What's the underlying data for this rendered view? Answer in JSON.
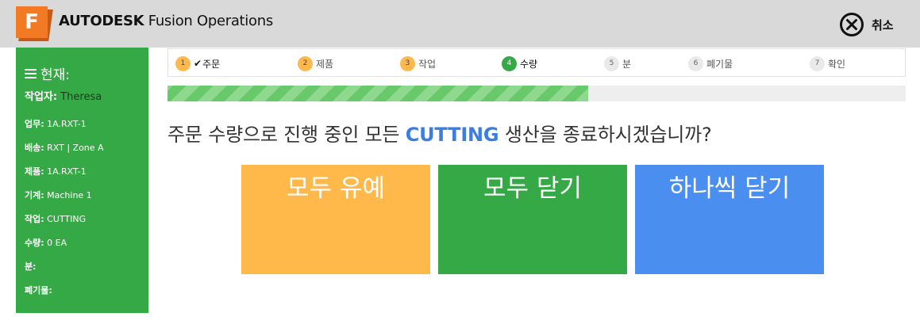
{
  "header": {
    "logo_letter": "F",
    "brand_bold": "AUTODESK",
    "brand_rest": "Fusion Operations",
    "cancel_label": "취소",
    "cancel_icon": "close-circle-icon"
  },
  "sidebar": {
    "title": "현재:",
    "worker_label": "작업자:",
    "worker_value": "Theresa",
    "rows": [
      {
        "label": "업무:",
        "value": "1A.RXT-1"
      },
      {
        "label": "배송:",
        "value": "RXT | Zone A"
      },
      {
        "label": "제품:",
        "value": "1A.RXT-1"
      },
      {
        "label": "기계:",
        "value": "Machine 1"
      },
      {
        "label": "작업:",
        "value": "CUTTING"
      },
      {
        "label": "수량:",
        "value": "0 EA"
      },
      {
        "label": "분:",
        "value": ""
      },
      {
        "label": "폐기물:",
        "value": ""
      }
    ]
  },
  "steps": [
    {
      "num": "1",
      "label": "주문",
      "state": "done"
    },
    {
      "num": "2",
      "label": "제품",
      "state": "done"
    },
    {
      "num": "3",
      "label": "작업",
      "state": "done"
    },
    {
      "num": "4",
      "label": "수량",
      "state": "current"
    },
    {
      "num": "5",
      "label": "분",
      "state": "pending"
    },
    {
      "num": "6",
      "label": "폐기물",
      "state": "pending"
    },
    {
      "num": "7",
      "label": "확인",
      "state": "pending"
    }
  ],
  "progress": {
    "fraction": 0.57
  },
  "question": {
    "before": "주문 수량으로 진행 중인 모든 ",
    "highlight": "CUTTING",
    "after": " 생산을 종료하시겠습니까?"
  },
  "actions": {
    "hold_all": "모두 유예",
    "close_all": "모두 닫기",
    "close_one_by_one": "하나씩 닫기"
  },
  "colors": {
    "accent_green": "#36a947",
    "accent_orange": "#ffb84a",
    "accent_blue": "#4a8ef0",
    "header_bg": "#d9d9d9"
  }
}
